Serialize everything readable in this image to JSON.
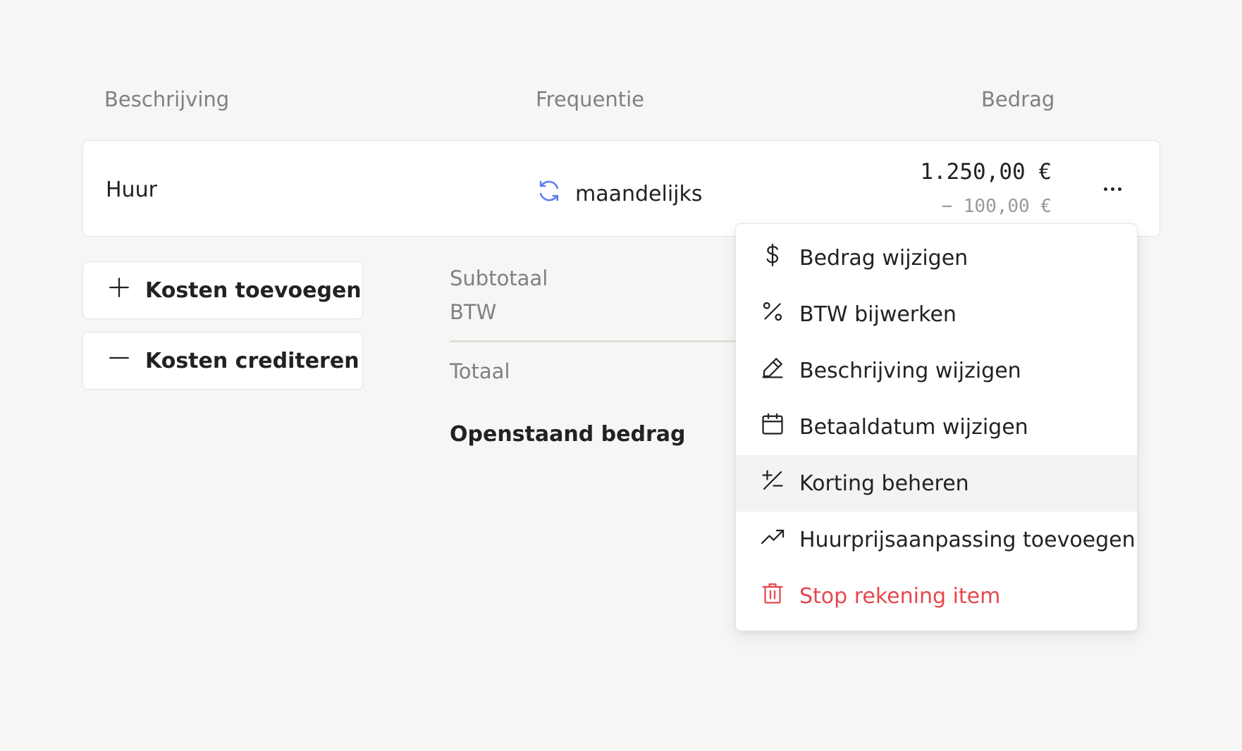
{
  "table": {
    "headers": {
      "description": "Beschrijving",
      "frequency": "Frequentie",
      "amount": "Bedrag"
    },
    "row": {
      "description": "Huur",
      "frequency": "maandelijks",
      "amount": "1.250,00 €",
      "discount": "− 100,00 €"
    }
  },
  "actions": {
    "add_costs": "Kosten toevoegen",
    "credit_costs": "Kosten crediteren"
  },
  "summary": {
    "subtotal": "Subtotaal",
    "vat": "BTW",
    "total": "Totaal",
    "outstanding": "Openstaand bedrag"
  },
  "menu": {
    "items": [
      {
        "label": "Bedrag wijzigen",
        "icon": "dollar-icon"
      },
      {
        "label": "BTW bijwerken",
        "icon": "percent-icon"
      },
      {
        "label": "Beschrijving wijzigen",
        "icon": "pencil-icon"
      },
      {
        "label": "Betaaldatum wijzigen",
        "icon": "calendar-icon"
      },
      {
        "label": "Korting beheren",
        "icon": "plus-minus-icon",
        "highlighted": true
      },
      {
        "label": "Huurprijsaanpassing toevoegen",
        "icon": "trend-up-icon"
      },
      {
        "label": "Stop rekening item",
        "icon": "trash-icon",
        "danger": true
      }
    ]
  },
  "colors": {
    "background": "#f7f6f4",
    "accent_blue": "#5b7cf0",
    "danger_red": "#e5484d"
  }
}
